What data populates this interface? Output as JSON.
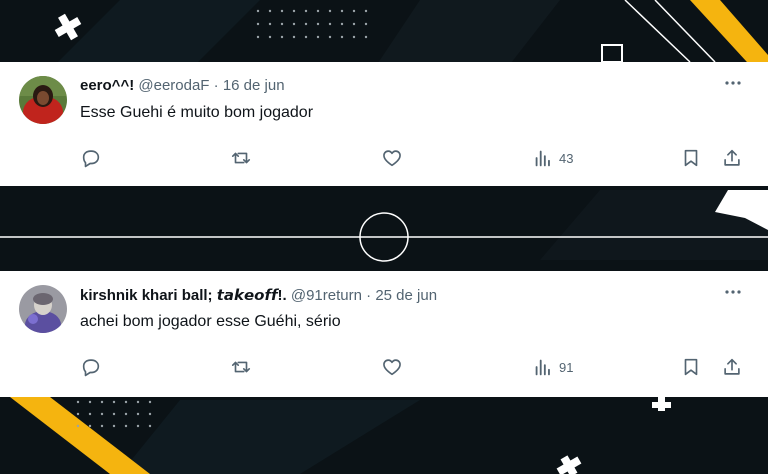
{
  "colors": {
    "accent_yellow": "#f5b40f",
    "background": "#0b1216",
    "card": "#ffffff",
    "muted": "#536471",
    "text": "#0f1419"
  },
  "tweets": [
    {
      "display_name": "eero^^!",
      "handle": "@eerodaF",
      "separator": "·",
      "date": "16 de jun",
      "text": "Esse Guehi é muito bom jogador",
      "views": "43",
      "icons": [
        "reply-icon",
        "retweet-icon",
        "like-icon",
        "views-icon",
        "bookmark-icon",
        "share-icon",
        "more-icon"
      ]
    },
    {
      "display_name": "kirshnik khari ball; 𝙩𝙖𝙠𝙚𝙤𝙛𝙛!.",
      "handle": "@91return",
      "separator": "·",
      "date": "25 de jun",
      "text": "achei bom jogador esse Guéhi, sério",
      "views": "91",
      "icons": [
        "reply-icon",
        "retweet-icon",
        "like-icon",
        "views-icon",
        "bookmark-icon",
        "share-icon",
        "more-icon"
      ]
    }
  ]
}
